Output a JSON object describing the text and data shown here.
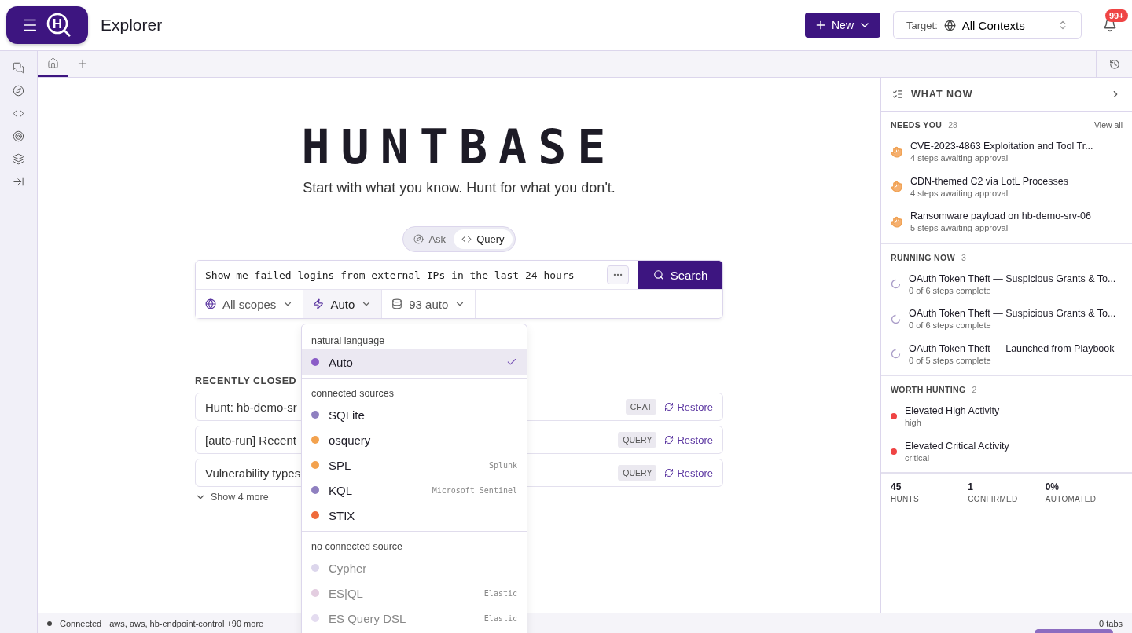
{
  "header": {
    "logo_letter": "H",
    "title": "Explorer",
    "new_button": "New",
    "target_label": "Target:",
    "target_value": "All Contexts",
    "notification_badge": "99+"
  },
  "tabs": [
    {
      "kind": "home",
      "selected": true
    },
    {
      "kind": "add",
      "selected": false
    }
  ],
  "hero": {
    "wordmark": "HUNTBASE",
    "tagline": "Start with what you know. Hunt for what you don't."
  },
  "mode_toggle": [
    {
      "label": "Ask",
      "kind": "ask",
      "selected": false
    },
    {
      "label": "Query",
      "kind": "query",
      "selected": true
    }
  ],
  "search": {
    "value": "Show me failed logins from external IPs in the last 24 hours",
    "button": "Search"
  },
  "filters": [
    {
      "label": "All scopes",
      "kind": "scope",
      "open": false
    },
    {
      "label": "Auto",
      "kind": "language",
      "open": true
    },
    {
      "label": "93 auto",
      "kind": "sources",
      "open": false
    }
  ],
  "dropdown": {
    "sections": [
      {
        "title": "natural language",
        "items": [
          {
            "name": "Auto",
            "color": "#8a5cc7",
            "selected": true,
            "disabled": false
          }
        ]
      },
      {
        "title": "connected sources",
        "items": [
          {
            "name": "SQLite",
            "color": "#8f80c0",
            "selected": false,
            "disabled": false
          },
          {
            "name": "osquery",
            "color": "#f3a24e",
            "selected": false,
            "disabled": false
          },
          {
            "name": "SPL",
            "color": "#f3a24e",
            "note": "Splunk",
            "selected": false,
            "disabled": false
          },
          {
            "name": "KQL",
            "color": "#8f80c0",
            "note": "Microsoft Sentinel",
            "selected": false,
            "disabled": false
          },
          {
            "name": "STIX",
            "color": "#ef6a3a",
            "selected": false,
            "disabled": false
          }
        ]
      },
      {
        "title": "no connected source",
        "items": [
          {
            "name": "Cypher",
            "color": "#dcd6ec",
            "selected": false,
            "disabled": true
          },
          {
            "name": "ES|QL",
            "color": "#e3cde0",
            "note": "Elastic",
            "selected": false,
            "disabled": true
          },
          {
            "name": "ES Query DSL",
            "color": "#e4dcf0",
            "note": "Elastic",
            "selected": false,
            "disabled": true
          }
        ]
      }
    ]
  },
  "recently_closed": {
    "title": "RECENTLY CLOSED",
    "rows": [
      {
        "title": "Hunt: hb-demo-sr",
        "tag": "CHAT",
        "action": "Restore"
      },
      {
        "title": "[auto-run] Recent",
        "tag": "QUERY",
        "action": "Restore"
      },
      {
        "title": "Vulnerability types",
        "tag": "QUERY",
        "action": "Restore"
      }
    ],
    "show_more": "Show 4 more"
  },
  "what_now": {
    "title": "WHAT NOW",
    "sections": [
      {
        "title": "NEEDS YOU",
        "count": "28",
        "link": "View all",
        "kind": "approval",
        "items": [
          {
            "title": "CVE-2023-4863 Exploitation and Tool Tr...",
            "subtitle": "4 steps awaiting approval"
          },
          {
            "title": "CDN-themed C2 via LotL Processes",
            "subtitle": "4 steps awaiting approval"
          },
          {
            "title": "Ransomware payload on hb-demo-srv-06",
            "subtitle": "5 steps awaiting approval"
          }
        ]
      },
      {
        "title": "RUNNING NOW",
        "count": "3",
        "kind": "running",
        "items": [
          {
            "title": "OAuth Token Theft — Suspicious Grants & To...",
            "subtitle": "0 of 6 steps complete"
          },
          {
            "title": "OAuth Token Theft — Suspicious Grants & To...",
            "subtitle": "0 of 6 steps complete"
          },
          {
            "title": "OAuth Token Theft — Launched from Playbook",
            "subtitle": "0 of 5 steps complete"
          }
        ]
      },
      {
        "title": "WORTH HUNTING",
        "count": "2",
        "kind": "signal",
        "items": [
          {
            "title": "Elevated High Activity",
            "subtitle": "high",
            "color": "#ef4444"
          },
          {
            "title": "Elevated Critical Activity",
            "subtitle": "critical",
            "color": "#ef4444"
          }
        ]
      }
    ],
    "stats": [
      {
        "value": "45",
        "label": "HUNTS"
      },
      {
        "value": "1",
        "label": "CONFIRMED"
      },
      {
        "value": "0%",
        "label": "AUTOMATED"
      }
    ]
  },
  "status_bar": {
    "connection": "Connected",
    "connected": true,
    "contexts": "aws, aws, hb-endpoint-control +90 more",
    "tabs": "0 tabs"
  }
}
